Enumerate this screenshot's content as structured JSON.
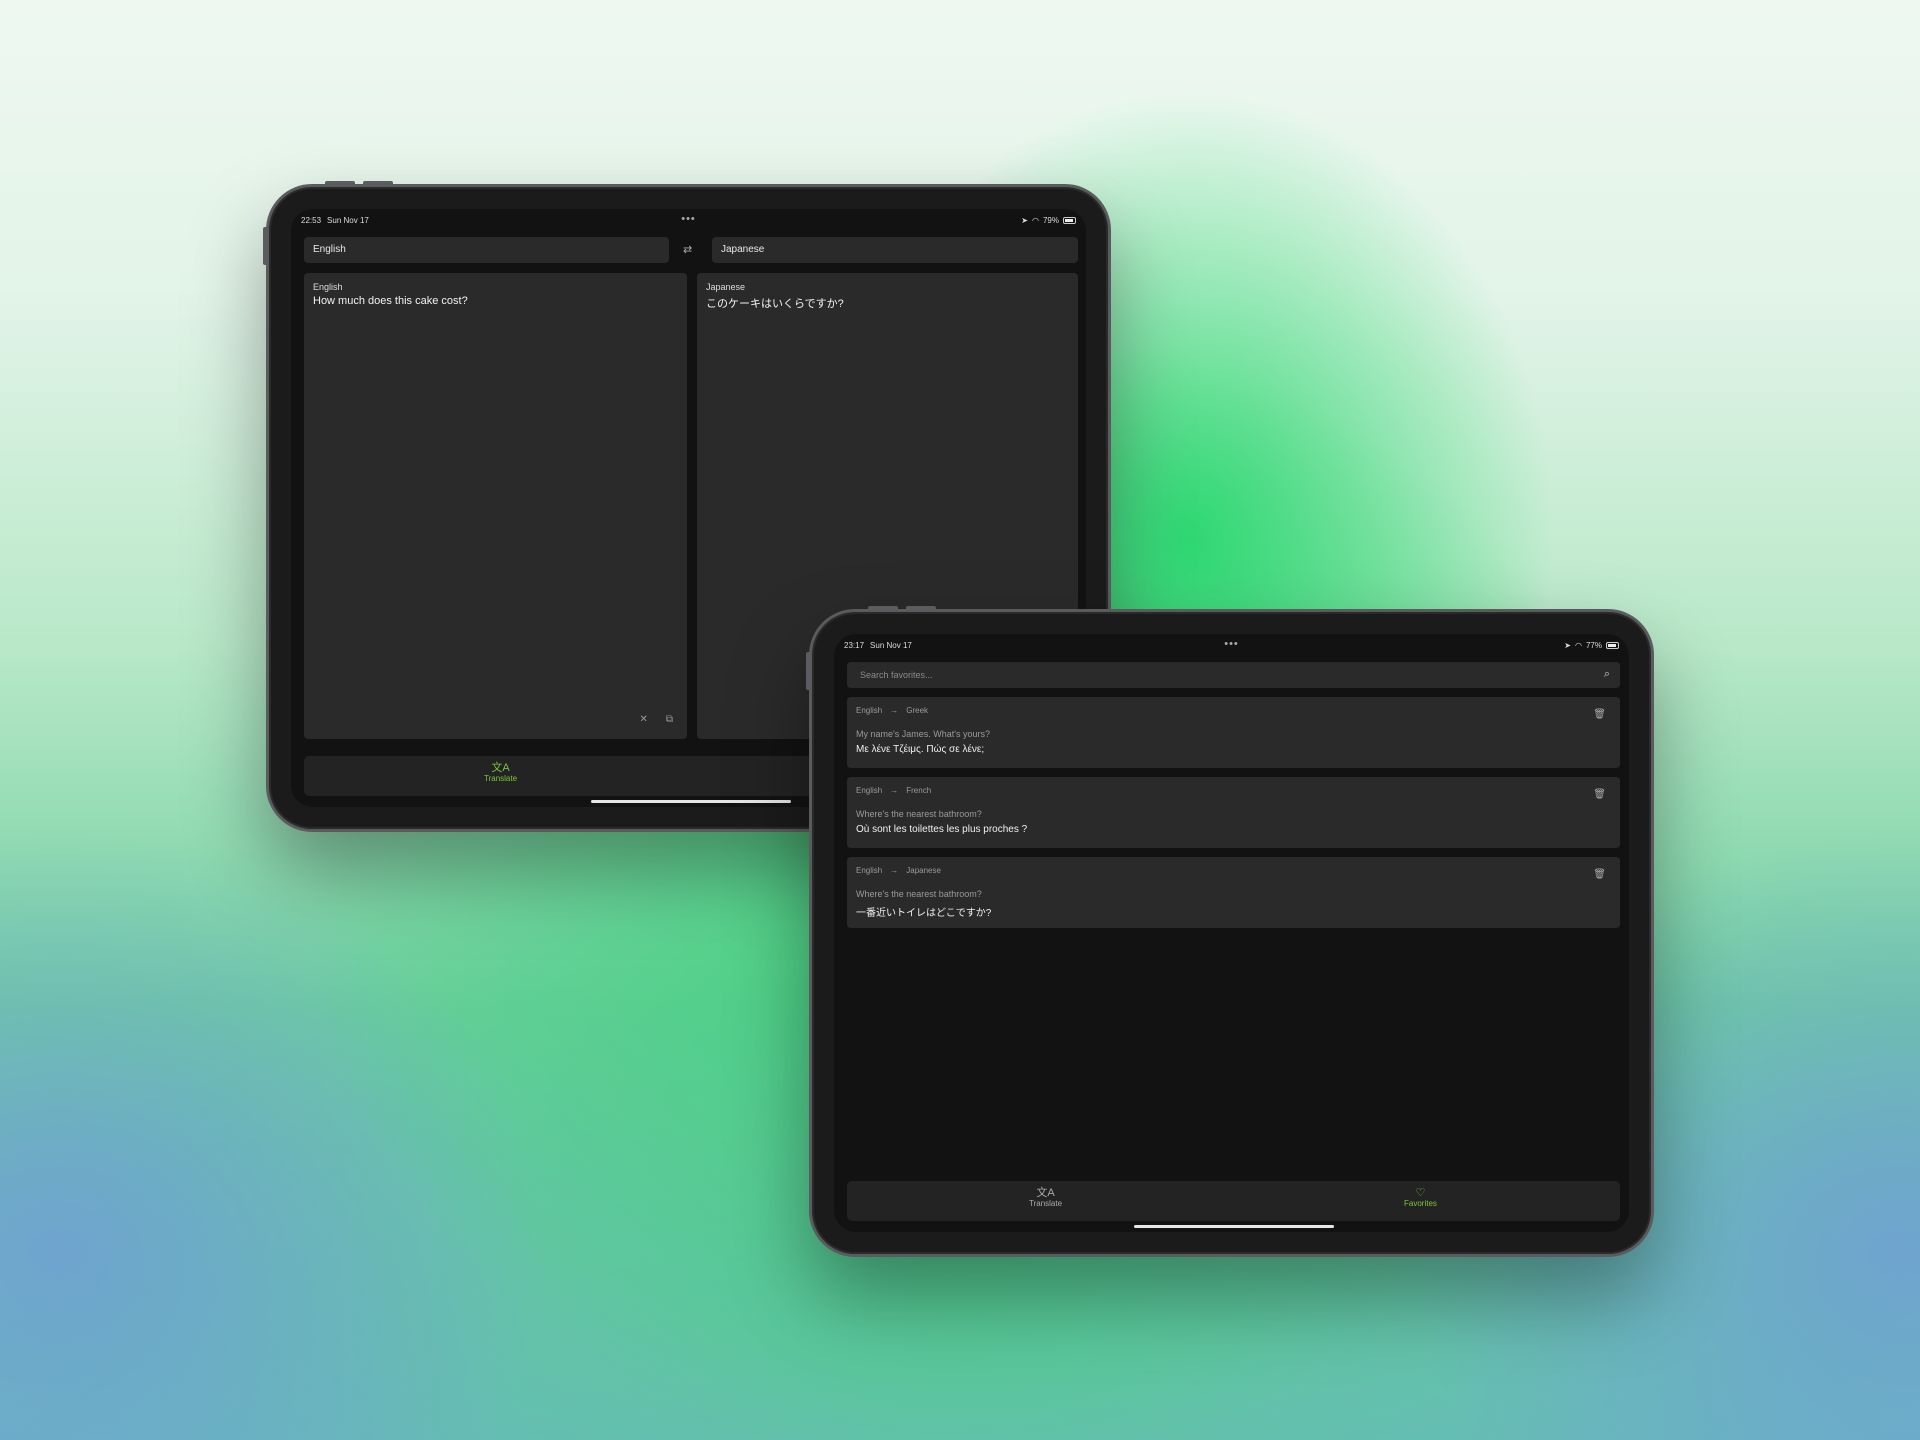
{
  "colors": {
    "accent": "#7cc53a",
    "screen": "#121212",
    "panel": "#2a2a2a"
  },
  "device_back": {
    "status": {
      "time": "22:53",
      "date": "Sun Nov 17",
      "battery": "79%"
    },
    "source_language": "English",
    "target_language": "Japanese",
    "swap_icon": "swap-arrows-icon",
    "source_panel": {
      "label": "English",
      "text": "How much does this cake cost?"
    },
    "target_panel": {
      "label": "Japanese",
      "text": "このケーキはいくらですか?"
    },
    "tabs": [
      {
        "label": "Translate",
        "icon": "translate-icon",
        "active": true
      }
    ]
  },
  "device_front": {
    "status": {
      "time": "23:17",
      "date": "Sun Nov 17",
      "battery": "77%"
    },
    "search": {
      "placeholder": "Search favorites..."
    },
    "favorites": [
      {
        "from": "English",
        "to": "Greek",
        "source": "My name's James. What's yours?",
        "translation": "Με λένε Τζέιμς. Πώς σε λένε;"
      },
      {
        "from": "English",
        "to": "French",
        "source": "Where's the nearest bathroom?",
        "translation": "Où sont les toilettes les plus proches ?"
      },
      {
        "from": "English",
        "to": "Japanese",
        "source": "Where's the nearest bathroom?",
        "translation": "一番近いトイレはどこですか?"
      }
    ],
    "tabs": [
      {
        "label": "Translate",
        "icon": "translate-icon",
        "active": false
      },
      {
        "label": "Favorites",
        "icon": "heart-icon",
        "active": true
      }
    ]
  }
}
